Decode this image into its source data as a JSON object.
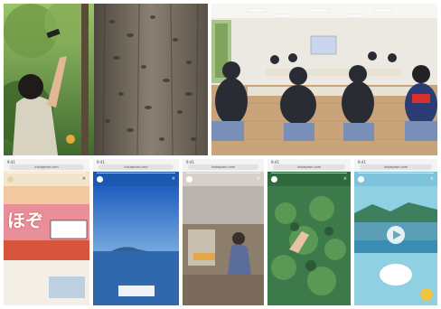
{
  "photos": {
    "forest": {
      "description_icon": "forest-photo"
    },
    "meeting": {
      "description_icon": "meeting-photo"
    }
  },
  "phones": [
    {
      "time": "9:41",
      "url": "instagram.com",
      "account": "",
      "headline": "ほぞ",
      "banner_text": "",
      "accent": "#f2c8a0"
    },
    {
      "time": "9:41",
      "url": "instagram.com",
      "account": "",
      "accent": "#2b6bc4"
    },
    {
      "time": "9:41",
      "url": "instagram.com",
      "account": "",
      "accent": "#cfcfcf"
    },
    {
      "time": "9:41",
      "url": "instagram.com",
      "account": "",
      "accent": "#3d7a4a"
    },
    {
      "time": "9:41",
      "url": "instagram.com",
      "account": "",
      "accent": "#5aa8c8"
    }
  ],
  "colors": {
    "forest_green": "#3f6a2e",
    "bark": "#6b6256",
    "room_floor": "#c9a47a"
  }
}
